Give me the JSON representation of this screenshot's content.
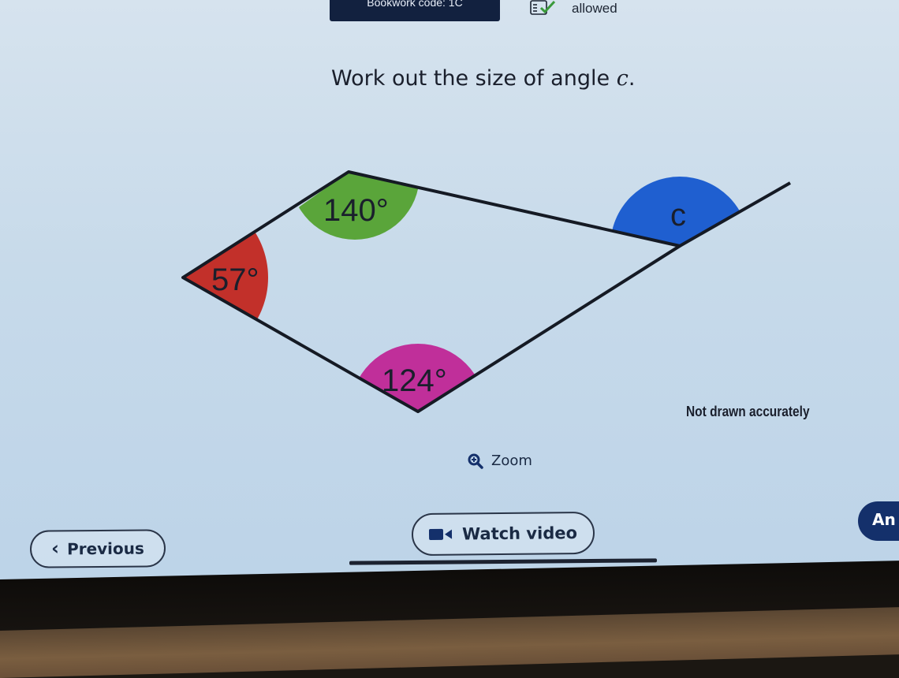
{
  "header": {
    "bookwork_code_label": "Bookwork code: 1C",
    "calculator_status": "allowed"
  },
  "question": {
    "text_prefix": "Work out the size of angle ",
    "variable": "c",
    "text_suffix": "."
  },
  "diagram": {
    "angles": [
      {
        "label": "140°",
        "color": "#5aa53a"
      },
      {
        "label": "57°",
        "color": "#c2302a"
      },
      {
        "label": "124°",
        "color": "#c02f9a"
      },
      {
        "label": "c",
        "color": "#1f5fd0"
      }
    ],
    "note": "Not drawn accurately"
  },
  "zoom": {
    "label": "Zoom",
    "icon": "magnifier-icon"
  },
  "nav": {
    "previous_label": "Previous",
    "video_label": "Watch video",
    "answer_label": "An"
  },
  "colors": {
    "navy": "#14306b",
    "text": "#1a1f2c"
  }
}
